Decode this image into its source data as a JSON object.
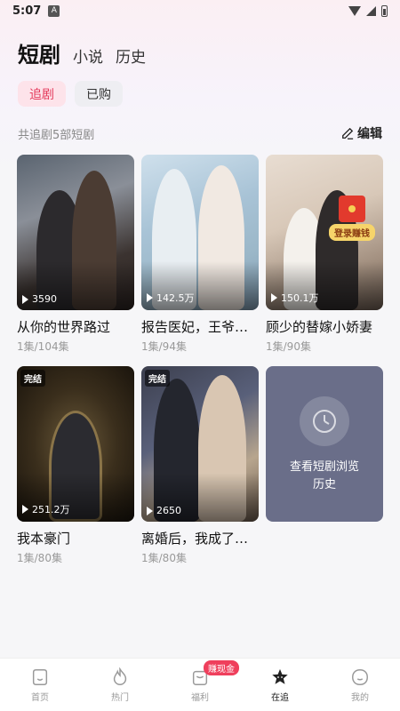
{
  "status_bar": {
    "time": "5:07",
    "notification_icon": "a-icon"
  },
  "top_tabs": [
    {
      "label": "短剧",
      "active": true
    },
    {
      "label": "小说",
      "active": false
    },
    {
      "label": "历史",
      "active": false
    }
  ],
  "sub_tabs": [
    {
      "label": "追剧",
      "active": true
    },
    {
      "label": "已购",
      "active": false
    }
  ],
  "summary": "共追剧5部短剧",
  "edit_label": "编辑",
  "dramas": [
    {
      "title": "从你的世界路过",
      "episodes": "1集/104集",
      "plays": "3590",
      "completed": false
    },
    {
      "title": "报告医妃，王爷他...",
      "episodes": "1集/94集",
      "plays": "142.5万",
      "completed": false
    },
    {
      "title": "顾少的替嫁小娇妻",
      "episodes": "1集/90集",
      "plays": "150.1万",
      "completed": false
    },
    {
      "title": "我本豪门",
      "episodes": "1集/80集",
      "plays": "251.2万",
      "completed": true
    },
    {
      "title": "离婚后，我成了千...",
      "episodes": "1集/80集",
      "plays": "2650",
      "completed": true
    }
  ],
  "badge_done": "完结",
  "ad": {
    "label": "登录赚钱",
    "close": "×"
  },
  "history_card": {
    "text": "查看短剧浏览历史"
  },
  "bottom_nav": [
    {
      "label": "首页",
      "icon": "home-icon",
      "active": false
    },
    {
      "label": "热门",
      "icon": "flame-icon",
      "active": false
    },
    {
      "label": "福利",
      "icon": "gift-icon",
      "active": false,
      "badge": "赚现金"
    },
    {
      "label": "在追",
      "icon": "star-icon",
      "active": true
    },
    {
      "label": "我的",
      "icon": "profile-icon",
      "active": false
    }
  ],
  "colors": {
    "accent": "#e4395a",
    "accent_bg": "#fde3ea",
    "history_card": "#6a6e89"
  }
}
